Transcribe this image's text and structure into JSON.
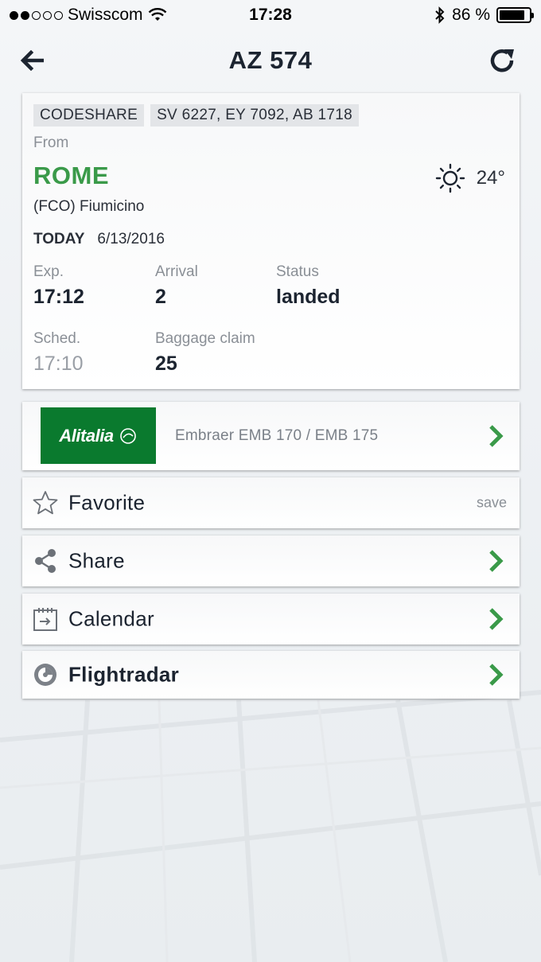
{
  "status_bar": {
    "carrier": "Swisscom",
    "time": "17:28",
    "battery_percent": "86 %",
    "battery_level": 0.86,
    "signal_bars_filled": 2,
    "signal_bars_total": 5
  },
  "nav": {
    "title": "AZ 574",
    "back_icon": "arrow-left-icon",
    "refresh_icon": "refresh-icon"
  },
  "flight": {
    "codeshare_label": "CODESHARE",
    "codeshare_flights": "SV 6227, EY 7092, AB 1718",
    "from_label": "From",
    "city": "ROME",
    "airport": "(FCO) Fiumicino",
    "weather_icon": "sun-icon",
    "temperature": "24°",
    "day_label": "TODAY",
    "date": "6/13/2016",
    "expected_label": "Exp.",
    "expected_time": "17:12",
    "arrival_label": "Arrival",
    "arrival_terminal": "2",
    "status_label": "Status",
    "status_value": "landed",
    "scheduled_label": "Sched.",
    "scheduled_time": "17:10",
    "baggage_label": "Baggage claim",
    "baggage_value": "25"
  },
  "aircraft": {
    "airline_logo_text": "Alitalia",
    "aircraft_type": "Embraer EMB 170 / EMB 175"
  },
  "actions": {
    "favorite_label": "Favorite",
    "favorite_action": "save",
    "share_label": "Share",
    "calendar_label": "Calendar",
    "flightradar_label": "Flightradar"
  },
  "colors": {
    "accent_green": "#3a9a49",
    "alitalia_green": "#0a7a2e",
    "text_dark": "#1c2430",
    "text_muted": "#8a8f96"
  }
}
